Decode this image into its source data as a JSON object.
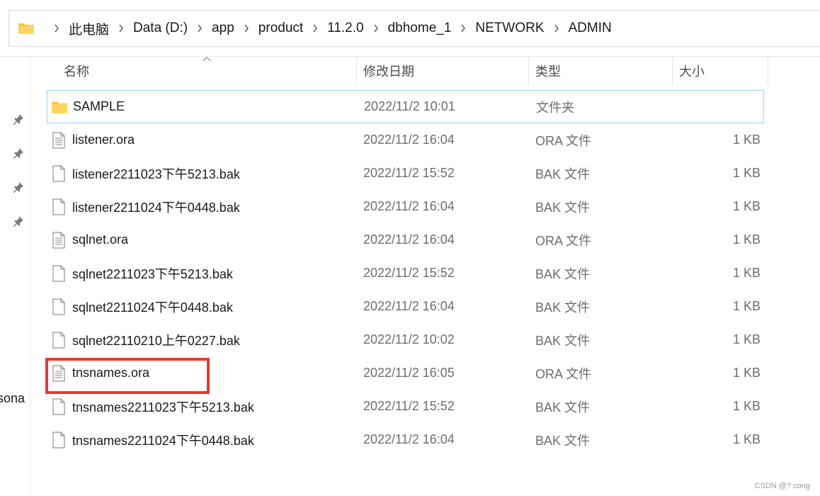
{
  "breadcrumb": [
    "此电脑",
    "Data (D:)",
    "app",
    "product",
    "11.2.0",
    "dbhome_1",
    "NETWORK",
    "ADMIN"
  ],
  "nav_partial_label": "rsona",
  "columns": {
    "name": "名称",
    "date": "修改日期",
    "type": "类型",
    "size": "大小"
  },
  "files": [
    {
      "name": "SAMPLE",
      "date": "2022/11/2 10:01",
      "type": "文件夹",
      "size": "",
      "icon": "folder-icon",
      "selected": true
    },
    {
      "name": "listener.ora",
      "date": "2022/11/2 16:04",
      "type": "ORA 文件",
      "size": "1 KB",
      "icon": "text-file-icon"
    },
    {
      "name": "listener2211023下午5213.bak",
      "date": "2022/11/2 15:52",
      "type": "BAK 文件",
      "size": "1 KB",
      "icon": "blank-file-icon"
    },
    {
      "name": "listener2211024下午0448.bak",
      "date": "2022/11/2 16:04",
      "type": "BAK 文件",
      "size": "1 KB",
      "icon": "blank-file-icon"
    },
    {
      "name": "sqlnet.ora",
      "date": "2022/11/2 16:04",
      "type": "ORA 文件",
      "size": "1 KB",
      "icon": "text-file-icon"
    },
    {
      "name": "sqlnet2211023下午5213.bak",
      "date": "2022/11/2 15:52",
      "type": "BAK 文件",
      "size": "1 KB",
      "icon": "blank-file-icon"
    },
    {
      "name": "sqlnet2211024下午0448.bak",
      "date": "2022/11/2 16:04",
      "type": "BAK 文件",
      "size": "1 KB",
      "icon": "blank-file-icon"
    },
    {
      "name": "sqlnet22110210上午0227.bak",
      "date": "2022/11/2 10:02",
      "type": "BAK 文件",
      "size": "1 KB",
      "icon": "blank-file-icon"
    },
    {
      "name": "tnsnames.ora",
      "date": "2022/11/2 16:05",
      "type": "ORA 文件",
      "size": "1 KB",
      "icon": "text-file-icon"
    },
    {
      "name": "tnsnames2211023下午5213.bak",
      "date": "2022/11/2 15:52",
      "type": "BAK 文件",
      "size": "1 KB",
      "icon": "blank-file-icon"
    },
    {
      "name": "tnsnames2211024下午0448.bak",
      "date": "2022/11/2 16:04",
      "type": "BAK 文件",
      "size": "1 KB",
      "icon": "blank-file-icon"
    }
  ],
  "highlighted_file": "tnsnames.ora",
  "watermark": "CSDN @? cong",
  "colors": {
    "highlight_box": "#e53935",
    "selection_border": "#99d1ff",
    "folder": "#f5c342"
  }
}
